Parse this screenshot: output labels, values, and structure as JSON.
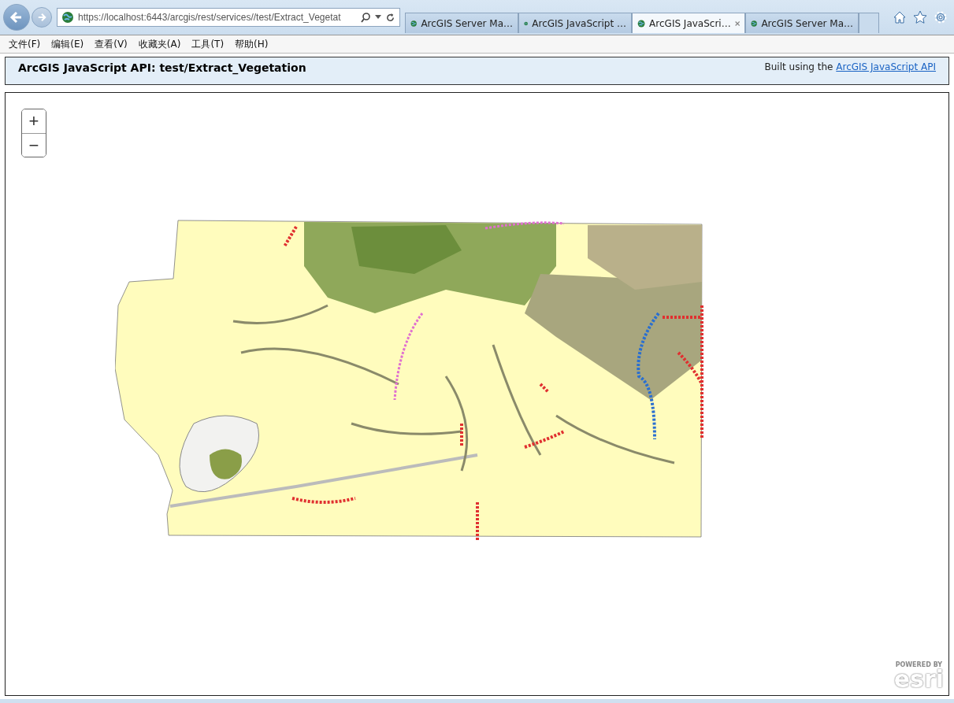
{
  "browser": {
    "address": "https://localhost:6443/arcgis/rest/services//test/Extract_Vegetat",
    "tabs": [
      {
        "title": "ArcGIS Server Ma…",
        "selected": false,
        "closable": false
      },
      {
        "title": "ArcGIS JavaScript …",
        "selected": false,
        "closable": false
      },
      {
        "title": "ArcGIS JavaScri…",
        "selected": true,
        "closable": true
      },
      {
        "title": "ArcGIS Server Ma…",
        "selected": false,
        "closable": false
      }
    ],
    "menu": [
      "文件(F)",
      "编辑(E)",
      "查看(V)",
      "收藏夹(A)",
      "工具(T)",
      "帮助(H)"
    ]
  },
  "header": {
    "title": "ArcGIS JavaScript API: test/Extract_Vegetation",
    "credit_text": "Built using the",
    "credit_link": "ArcGIS JavaScript API"
  },
  "map": {
    "zoom_in": "+",
    "zoom_out": "−",
    "logo_caption": "POWERED BY",
    "logo_text": "esri"
  }
}
